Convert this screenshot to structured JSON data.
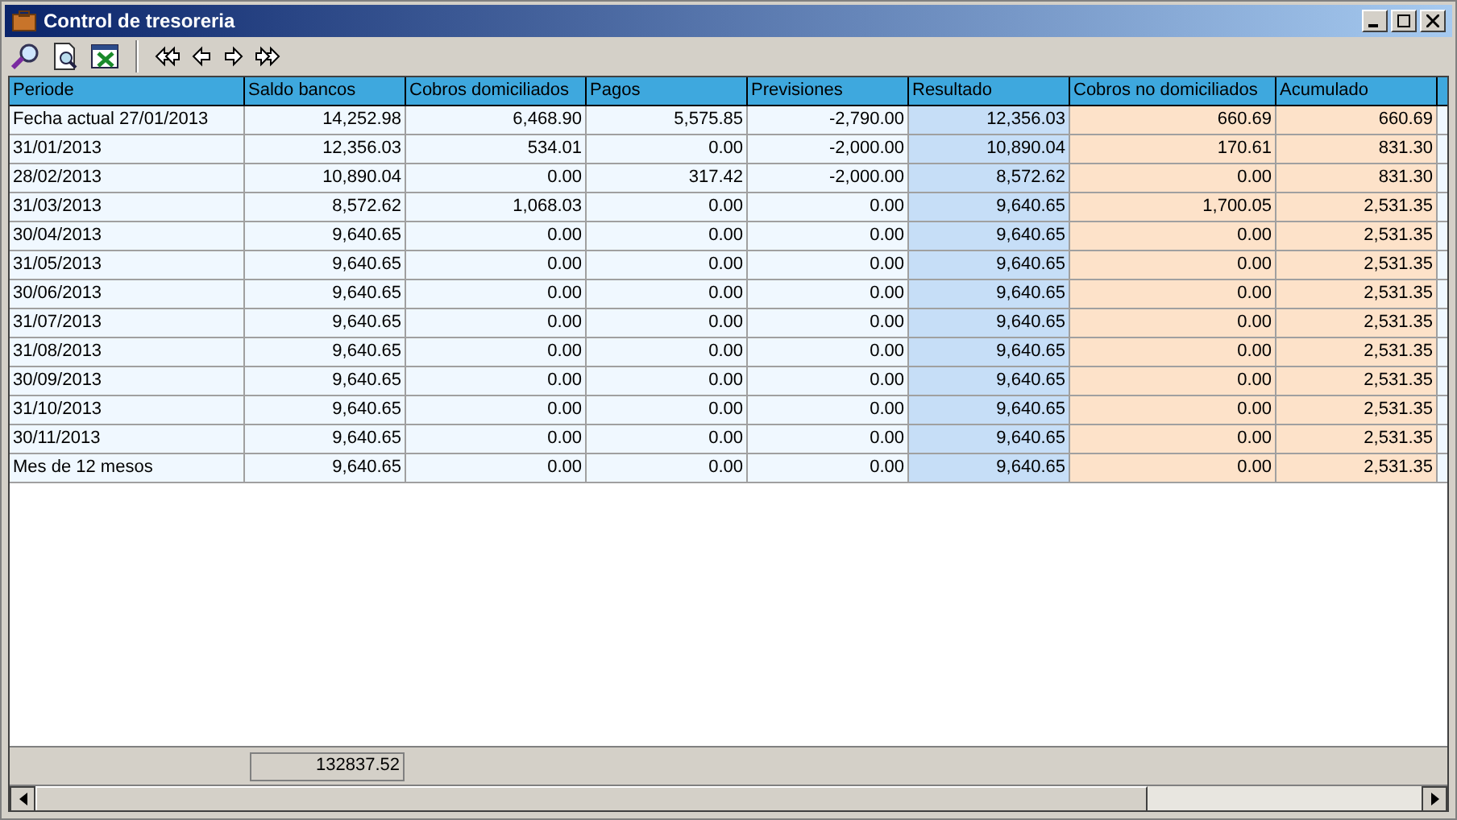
{
  "window": {
    "title": "Control de tresoreria"
  },
  "toolbar": [
    {
      "kind": "search"
    },
    {
      "kind": "preview"
    },
    {
      "kind": "excel"
    },
    {
      "kind": "separator"
    },
    {
      "kind": "first"
    },
    {
      "kind": "prev"
    },
    {
      "kind": "next"
    },
    {
      "kind": "last"
    }
  ],
  "table": {
    "columns": [
      {
        "label": "Periode",
        "color": "#f0f8ff"
      },
      {
        "label": "Saldo bancos",
        "color": "#f0f8ff"
      },
      {
        "label": "Cobros domiciliados",
        "color": "#f0f8ff"
      },
      {
        "label": "Pagos",
        "color": "#f0f8ff"
      },
      {
        "label": "Previsiones",
        "color": "#f0f8ff"
      },
      {
        "label": "Resultado",
        "color": "#c6def7"
      },
      {
        "label": "Cobros no domiciliados",
        "color": "#fde2c9"
      },
      {
        "label": "Acumulado",
        "color": "#fde2c9"
      },
      {
        "color": "#f0f8ff"
      }
    ],
    "rows": [
      [
        "Fecha actual 27/01/2013",
        "14,252.98",
        "6,468.90",
        "5,575.85",
        "-2,790.00",
        "12,356.03",
        "660.69",
        "660.69"
      ],
      [
        "31/01/2013",
        "12,356.03",
        "534.01",
        "0.00",
        "-2,000.00",
        "10,890.04",
        "170.61",
        "831.30"
      ],
      [
        "28/02/2013",
        "10,890.04",
        "0.00",
        "317.42",
        "-2,000.00",
        "8,572.62",
        "0.00",
        "831.30"
      ],
      [
        "31/03/2013",
        "8,572.62",
        "1,068.03",
        "0.00",
        "0.00",
        "9,640.65",
        "1,700.05",
        "2,531.35"
      ],
      [
        "30/04/2013",
        "9,640.65",
        "0.00",
        "0.00",
        "0.00",
        "9,640.65",
        "0.00",
        "2,531.35"
      ],
      [
        "31/05/2013",
        "9,640.65",
        "0.00",
        "0.00",
        "0.00",
        "9,640.65",
        "0.00",
        "2,531.35"
      ],
      [
        "30/06/2013",
        "9,640.65",
        "0.00",
        "0.00",
        "0.00",
        "9,640.65",
        "0.00",
        "2,531.35"
      ],
      [
        "31/07/2013",
        "9,640.65",
        "0.00",
        "0.00",
        "0.00",
        "9,640.65",
        "0.00",
        "2,531.35"
      ],
      [
        "31/08/2013",
        "9,640.65",
        "0.00",
        "0.00",
        "0.00",
        "9,640.65",
        "0.00",
        "2,531.35"
      ],
      [
        "30/09/2013",
        "9,640.65",
        "0.00",
        "0.00",
        "0.00",
        "9,640.65",
        "0.00",
        "2,531.35"
      ],
      [
        "31/10/2013",
        "9,640.65",
        "0.00",
        "0.00",
        "0.00",
        "9,640.65",
        "0.00",
        "2,531.35"
      ],
      [
        "30/11/2013",
        "9,640.65",
        "0.00",
        "0.00",
        "0.00",
        "9,640.65",
        "0.00",
        "2,531.35"
      ],
      [
        "Mes de 12 mesos",
        "9,640.65",
        "0.00",
        "0.00",
        "0.00",
        "9,640.65",
        "0.00",
        "2,531.35"
      ]
    ]
  },
  "footer": {
    "total": "132837.52"
  }
}
